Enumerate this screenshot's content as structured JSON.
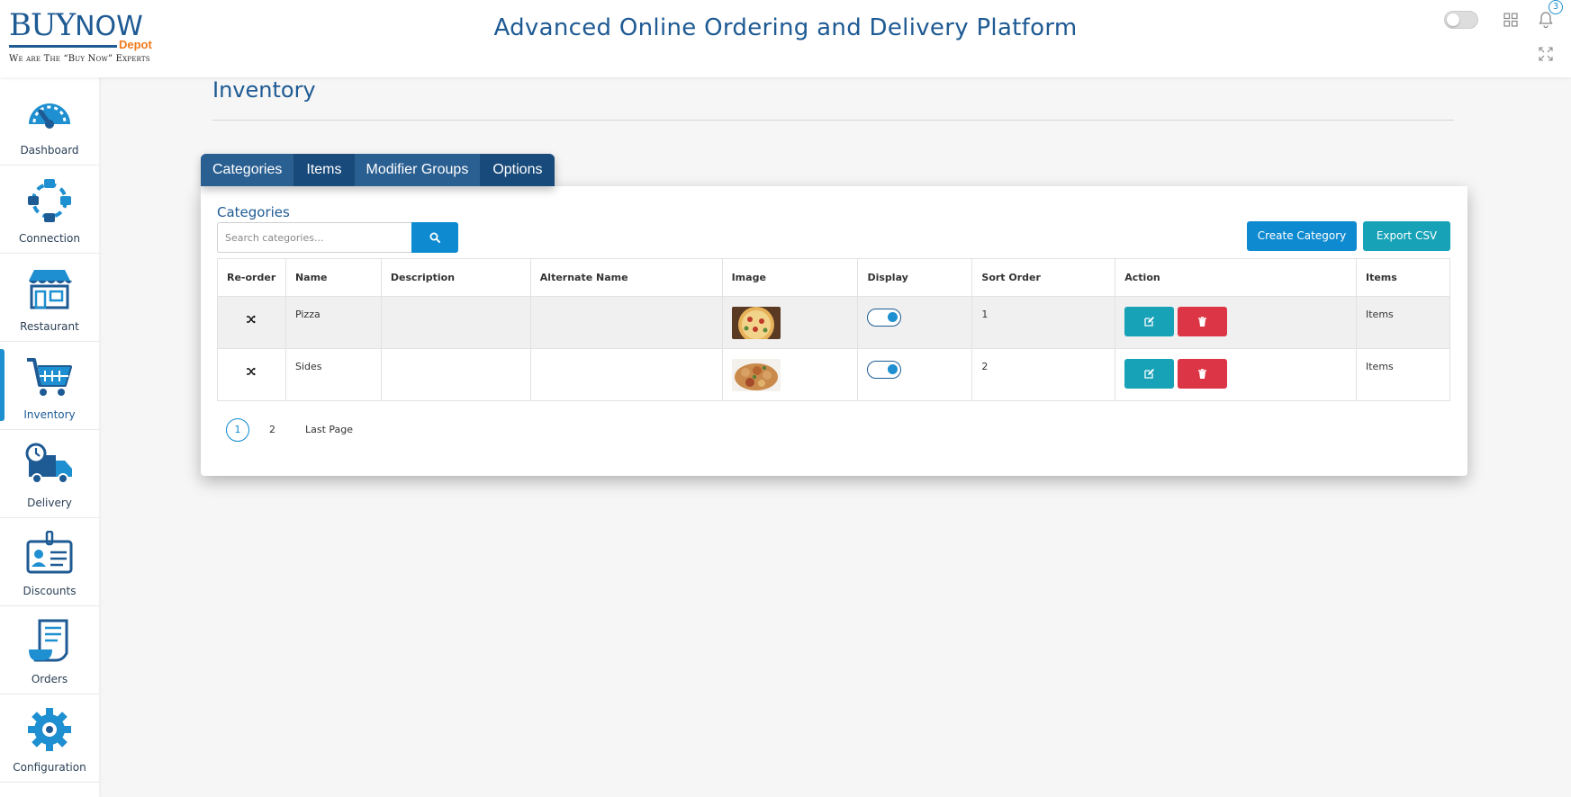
{
  "header": {
    "logo_buy": "BUY",
    "logo_now": "NOW",
    "logo_depot": "Depot",
    "logo_tagline": "We are The “Buy Now” Experts",
    "app_title": "Advanced Online Ordering and Delivery Platform",
    "notification_count": "3"
  },
  "sidebar": {
    "items": [
      {
        "label": "Dashboard",
        "icon": "speedometer-icon"
      },
      {
        "label": "Connection",
        "icon": "connection-icon"
      },
      {
        "label": "Restaurant",
        "icon": "storefront-icon"
      },
      {
        "label": "Inventory",
        "icon": "cart-icon",
        "active": true
      },
      {
        "label": "Delivery",
        "icon": "delivery-truck-icon"
      },
      {
        "label": "Discounts",
        "icon": "id-card-icon"
      },
      {
        "label": "Orders",
        "icon": "receipt-icon"
      },
      {
        "label": "Configuration",
        "icon": "gear-icon"
      }
    ]
  },
  "page": {
    "title": "Inventory"
  },
  "tabs": [
    {
      "label": "Categories"
    },
    {
      "label": "Items"
    },
    {
      "label": "Modifier Groups"
    },
    {
      "label": "Options"
    }
  ],
  "card": {
    "title": "Categories",
    "search_placeholder": "Search categories...",
    "create_label": "Create Category",
    "export_label": "Export CSV"
  },
  "table": {
    "columns": [
      "Re-order",
      "Name",
      "Description",
      "Alternate Name",
      "Image",
      "Display",
      "Sort Order",
      "Action",
      "Items"
    ],
    "rows": [
      {
        "name": "Pizza",
        "description": "",
        "alternate_name": "",
        "display": true,
        "sort_order": "1",
        "items_link": "Items"
      },
      {
        "name": "Sides",
        "description": "",
        "alternate_name": "",
        "display": true,
        "sort_order": "2",
        "items_link": "Items"
      }
    ]
  },
  "pagination": {
    "current": "1",
    "next": "2",
    "last_label": "Last Page"
  },
  "colors": {
    "brand_blue": "#1e5a93",
    "primary_button": "#0d8ad0",
    "info_button": "#17a2b8",
    "danger_button": "#dc3545",
    "logo_orange": "#f07a1a"
  }
}
